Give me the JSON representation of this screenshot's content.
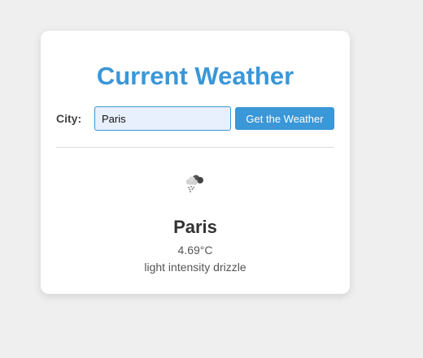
{
  "card": {
    "title": "Current Weather"
  },
  "form": {
    "city_label": "City:",
    "city_value": "Paris",
    "submit_label": "Get the Weather"
  },
  "result": {
    "icon": "light-drizzle-cloud-icon",
    "city": "Paris",
    "temperature": "4.69°C",
    "description": "light intensity drizzle"
  },
  "colors": {
    "accent": "#3a97d8",
    "background": "#efefef",
    "card": "#ffffff",
    "input_fill": "#e8f0fd"
  }
}
